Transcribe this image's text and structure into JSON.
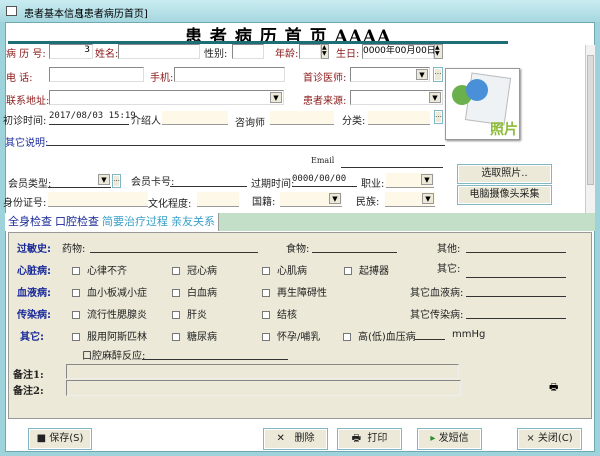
{
  "window": {
    "title": "患者基本信息",
    "subtitle": "[患者病历首页]"
  },
  "heading": "患 者 病 历 首 页 AAAA",
  "form": {
    "record_no_label": "病 历 号:",
    "record_no": "3",
    "name_label": "姓名:",
    "gender_label": "性别:",
    "age_label": "年龄:",
    "birthday_label": "生日:",
    "birthday": "0000年00月00日",
    "phone_label": "电    话:",
    "mobile_label": "手机:",
    "doctor_label": "首诊医师:",
    "address_label": "联系地址:",
    "source_label": "患者来源:",
    "first_visit_label": "初诊时间:",
    "first_visit": "2017/08/03 15:19",
    "referrer_label": "介绍人",
    "consultant_label": "咨询师",
    "category_label": "分类:",
    "notes_label": "其它说明:",
    "email_label": "Email",
    "member_type_label": "会员类型:",
    "member_card_label": "会员卡号:",
    "expiry_label": "过期时间:",
    "expiry": "0000/00/00",
    "job_label": "职业:",
    "id_label": "身份证号:",
    "education_label": "文化程度:",
    "nationality_label": "国籍:",
    "ethnicity_label": "民族:"
  },
  "photo": {
    "label": "照片",
    "select_button": "选取照片..",
    "camera_button": "电脑摄像头采集"
  },
  "tabs": [
    {
      "label": "全身检查",
      "active": true
    },
    {
      "label": "口腔检查"
    },
    {
      "label": "简要治疗过程"
    },
    {
      "label": "亲友关系"
    }
  ],
  "exam": {
    "allergy_label": "过敏史:",
    "drug_label": "药物:",
    "food_label": "食物:",
    "other_label": "其他:",
    "heart_label": "心脏病:",
    "heart": [
      "心律不齐",
      "冠心病",
      "心肌病",
      "起搏器"
    ],
    "heart_other": "其它:",
    "blood_label": "血液病:",
    "blood": [
      "血小板减小症",
      "白血病",
      "再生障碍性"
    ],
    "blood_other": "其它血液病:",
    "infect_label": "传染病:",
    "infect": [
      "流行性腮腺炎",
      "肝炎",
      "结核"
    ],
    "infect_other": "其它传染病:",
    "misc_label": "其它:",
    "misc": [
      "服用阿斯匹林",
      "糖尿病",
      "怀孕/哺乳",
      "高(低)血压病"
    ],
    "unit": "mmHg",
    "anesthesia_label": "口腔麻醉反应:",
    "remark1_label": "备注1:",
    "remark2_label": "备注2:"
  },
  "buttons": {
    "save": "保存(S)",
    "delete": "删除",
    "print": "打印",
    "sms": "发短信",
    "close": "关闭(C)"
  }
}
